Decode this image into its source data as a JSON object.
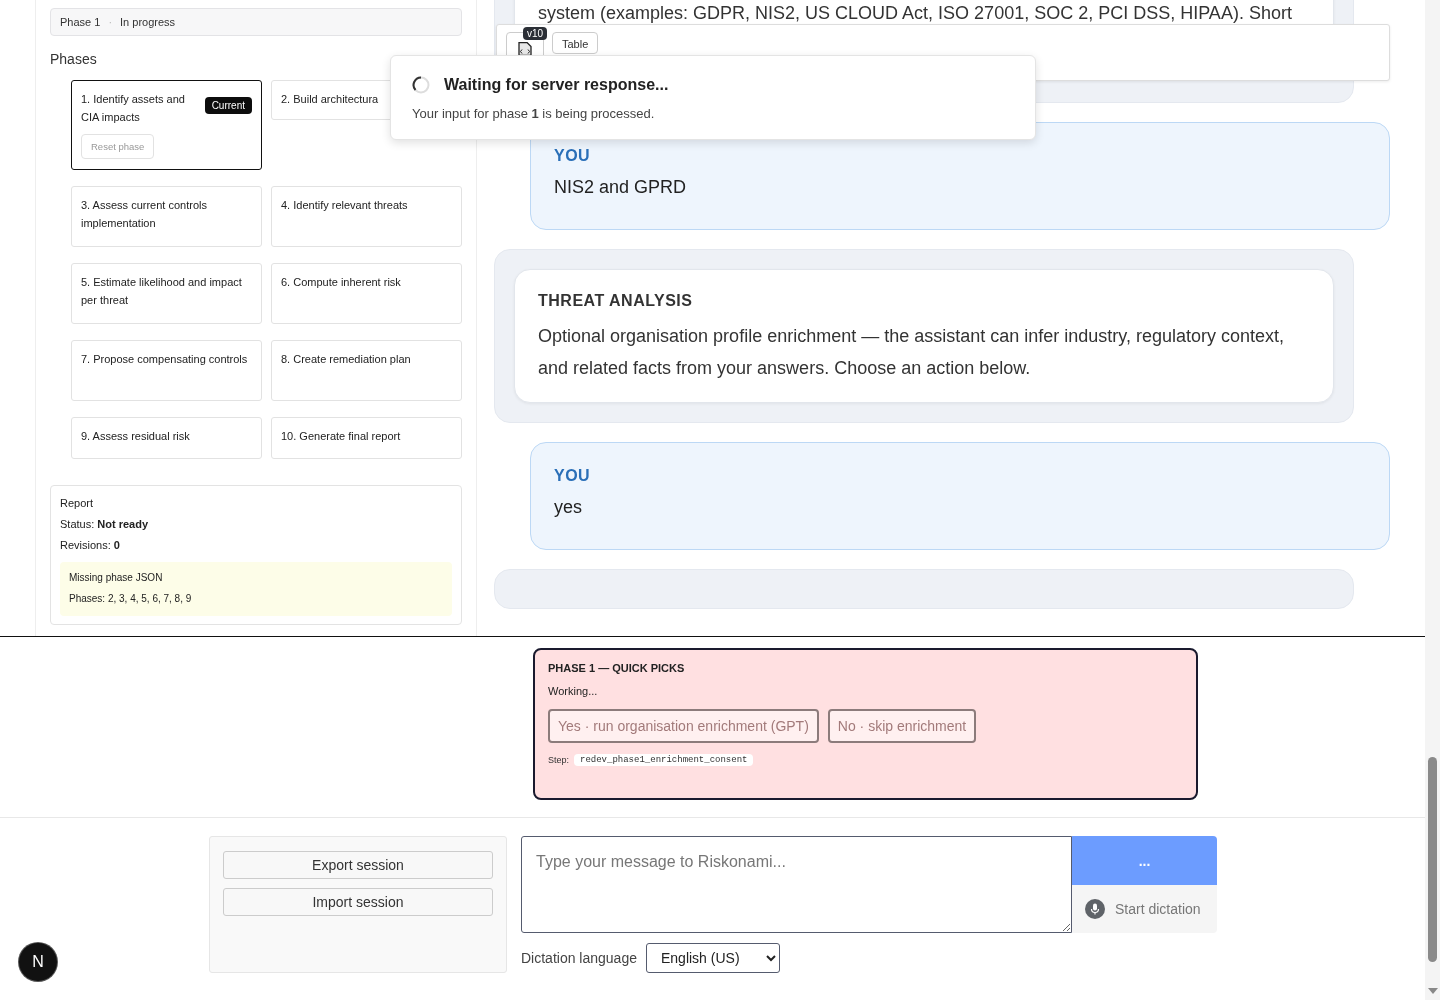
{
  "sidebar": {
    "status": {
      "phase": "Phase 1",
      "separator": "·",
      "state": "In progress"
    },
    "phases_title": "Phases",
    "phases": [
      {
        "label": "1. Identify assets and CIA impacts",
        "selected": true,
        "badge": "Current",
        "action": "Reset phase"
      },
      {
        "label": "2. Build architectura",
        "selected": false
      },
      {
        "label": "3. Assess current controls implementation",
        "selected": false
      },
      {
        "label": "4. Identify relevant threats",
        "selected": false
      },
      {
        "label": "5. Estimate likelihood and impact per threat",
        "selected": false
      },
      {
        "label": "6. Compute inherent risk",
        "selected": false
      },
      {
        "label": "7. Propose compensating controls",
        "selected": false
      },
      {
        "label": "8. Create remediation plan",
        "selected": false
      },
      {
        "label": "9. Assess residual risk",
        "selected": false
      },
      {
        "label": "10. Generate final report",
        "selected": false
      }
    ],
    "report": {
      "title": "Report",
      "status": "Status: **Not ready**",
      "revisions": "Revisions: **0**",
      "warning_title": "Missing phase JSON",
      "warning_text": "Phases: 2, 3, 4, 5, 6, 7, 8, 9"
    }
  },
  "chat": {
    "toolbar": {
      "version": "v10",
      "button": "Table"
    },
    "messages": [
      {
        "kind": "assistant",
        "text": "system (examples: GDPR, NIS2, US CLOUD Act, ISO 27001, SOC 2, PCI DSS, HIPAA). Short"
      },
      {
        "kind": "user",
        "author": "YOU",
        "text": "NIS2 and GPRD"
      },
      {
        "kind": "assistant",
        "title": "THREAT ANALYSIS",
        "text": "Optional organisation profile enrichment — the assistant can infer industry, regulatory context, and related facts from your answers. Choose an action below."
      },
      {
        "kind": "user",
        "author": "YOU",
        "text": "yes"
      },
      {
        "kind": "assistant"
      }
    ]
  },
  "toast": {
    "title": "Waiting for server response...",
    "text": "Your input for phase **1** is being processed."
  },
  "quick_picks": {
    "title": "PHASE 1 — QUICK PICKS",
    "status": "Working...",
    "buttons": [
      {
        "label": "Yes · run organisation enrichment (GPT)",
        "disabled": true
      },
      {
        "label": "No · skip enrichment",
        "disabled": true
      }
    ],
    "step_label": "Step:",
    "step": "redev_phase1_enrichment_consent"
  },
  "session_buttons": [
    "Export session",
    "Import session"
  ],
  "composer": {
    "placeholder": "Type your message to Riskonami...",
    "send": "...",
    "dictation": "Start dictation",
    "language_label": "Dictation language",
    "language": "English (US)"
  },
  "user_avatar": "N"
}
